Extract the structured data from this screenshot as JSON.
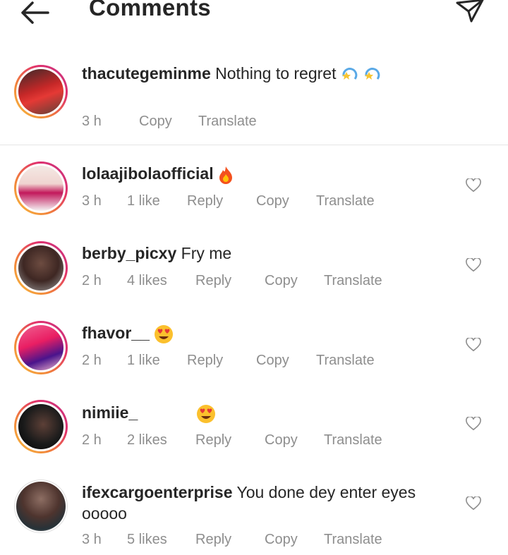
{
  "header": {
    "title": "Comments"
  },
  "caption": {
    "username": "thacutegeminme",
    "text": "Nothing to regret",
    "emoji": [
      "dizzy-emoji",
      "dizzy-emoji"
    ],
    "time": "3 h",
    "copy": "Copy",
    "translate": "Translate"
  },
  "comments": [
    {
      "username": "lolaajibolaofficial",
      "text": "",
      "emoji": "fire-emoji",
      "time": "3 h",
      "likes": "1 like",
      "reply": "Reply",
      "copy": "Copy",
      "translate": "Translate"
    },
    {
      "username": "berby_picxy",
      "text": "Fry me",
      "emoji": "",
      "time": "2 h",
      "likes": "4 likes",
      "reply": "Reply",
      "copy": "Copy",
      "translate": "Translate"
    },
    {
      "username": "fhavor__",
      "text": "",
      "emoji": "heart-eyes-emoji",
      "time": "2 h",
      "likes": "1 like",
      "reply": "Reply",
      "copy": "Copy",
      "translate": "Translate"
    },
    {
      "username": "nimiie_",
      "text": "",
      "emoji": "heart-eyes-emoji",
      "time": "2 h",
      "likes": "2 likes",
      "reply": "Reply",
      "copy": "Copy",
      "translate": "Translate"
    },
    {
      "username": "ifexcargoenterprise",
      "text": "You done dey enter eyes",
      "text_line2": "ooooo",
      "emoji": "",
      "time": "3 h",
      "likes": "5 likes",
      "reply": "Reply",
      "copy": "Copy",
      "translate": "Translate"
    }
  ],
  "colors": {
    "text": "#262626",
    "meta": "#8e8e8e",
    "ring_start": "#f9c23c",
    "ring_end": "#c13584"
  }
}
